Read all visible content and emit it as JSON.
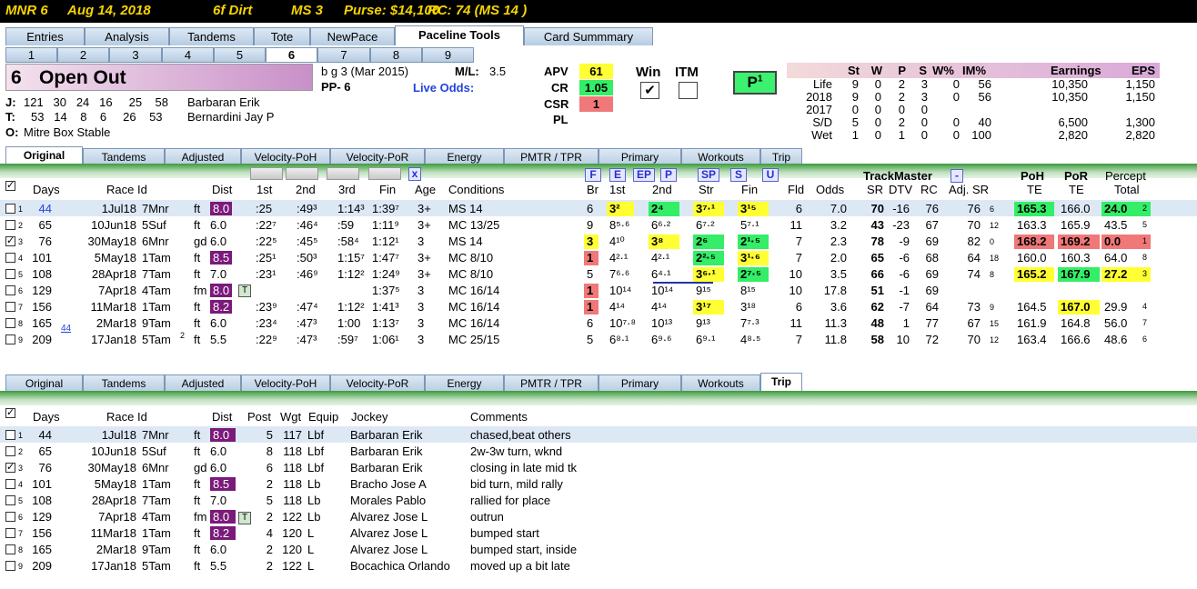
{
  "header": {
    "track": "MNR  6",
    "date": "Aug 14, 2018",
    "dist": "6f  Dirt",
    "cls": "MS  3",
    "purse": "Purse: $14,100",
    "rc": "RC: 74  (MS 14 )"
  },
  "main_tabs": [
    "Entries",
    "Analysis",
    "Tandems",
    "Tote",
    "NewPace",
    "Paceline Tools",
    "Card Summmary"
  ],
  "race_tabs": [
    "1",
    "2",
    "3",
    "4",
    "5",
    "6",
    "7",
    "8",
    "9"
  ],
  "horse": {
    "num": "6",
    "name": "Open Out",
    "desc": "b g 3  (Mar 2015)",
    "pp": "PP- 6",
    "ml_label": "M/L:",
    "ml": "3.5",
    "live": "Live Odds:",
    "j_label": "J:",
    "j_stats": "121   30   24   16     25    58",
    "jockey": "Barbaran Erik",
    "t_label": "T:",
    "t_stats": "53   14    8    6     26    53",
    "trainer": "Bernardini Jay P",
    "o_label": "O:",
    "owner": "Mitre Box Stable"
  },
  "ratings": {
    "apv_l": "APV",
    "apv": "61",
    "cr_l": "CR",
    "cr": "1.05",
    "csr_l": "CSR",
    "csr": "1",
    "pl_l": "PL",
    "win": "Win",
    "itm": "ITM",
    "p": "P",
    "p_sup": "1"
  },
  "stats": {
    "head": [
      "St",
      "W",
      "P",
      "S",
      "W%",
      "IM%",
      "Earnings",
      "EPS"
    ],
    "rows": [
      [
        "Life",
        "9",
        "0",
        "2",
        "3",
        "0",
        "56",
        "10,350",
        "1,150"
      ],
      [
        "2018",
        "9",
        "0",
        "2",
        "3",
        "0",
        "56",
        "10,350",
        "1,150"
      ],
      [
        "2017",
        "0",
        "0",
        "0",
        "0",
        "",
        "",
        "",
        ""
      ],
      [
        "S/D",
        "5",
        "0",
        "2",
        "0",
        "0",
        "40",
        "6,500",
        "1,300"
      ],
      [
        "Wet",
        "1",
        "0",
        "1",
        "0",
        "0",
        "100",
        "2,820",
        "2,820"
      ]
    ]
  },
  "view_tabs": [
    "Original",
    "Tandems",
    "Adjusted",
    "Velocity-PoH",
    "Velocity-PoR",
    "Energy",
    "PMTR / TPR",
    "Primary",
    "Workouts",
    "Trip"
  ],
  "pp_head": {
    "days": "Days",
    "raceid": "Race Id",
    "dist": "Dist",
    "c1": "1st",
    "c2": "2nd",
    "c3": "3rd",
    "fin": "Fin",
    "age": "Age",
    "cond": "Conditions",
    "x": "x",
    "btn": [
      "F",
      "E",
      "EP",
      "P",
      "SP",
      "S",
      "U"
    ],
    "br": "Br",
    "p1": "1st",
    "p2": "2nd",
    "str": "Str",
    "pfin": "Fin",
    "fld": "Fld",
    "odds": "Odds",
    "tm": "TrackMaster",
    "sr": "SR",
    "dtv": "DTV",
    "rc": "RC",
    "adjsr": "Adj. SR",
    "minus": "-",
    "poh": "PoH",
    "te1": "TE",
    "por": "PoR",
    "te2": "TE",
    "pct": "Percept",
    "total": "Total"
  },
  "pp_rows": [
    [
      "1",
      "44",
      "1Jul18",
      "7Mnr",
      "ft",
      "8.0",
      ":25",
      ":49³",
      "1:14³",
      "1:39⁷",
      "3+",
      "MS 14",
      "6",
      "3²",
      "2⁴",
      "3⁷·¹",
      "3¹⁵",
      "6",
      "7.0",
      "70",
      "-16",
      "76",
      "76",
      "6",
      "165.3",
      "166.0",
      "24.0",
      "2"
    ],
    [
      "2",
      "65",
      "10Jun18",
      "5Suf",
      "ft",
      "6.0",
      ":22⁷",
      ":46⁴",
      ":59",
      "1:11⁹",
      "3+",
      "MC 13/25",
      "9",
      "8⁵·⁶",
      "6⁶·²",
      "6⁷·²",
      "5⁷·¹",
      "11",
      "3.2",
      "43",
      "-23",
      "67",
      "70",
      "12",
      "163.3",
      "165.9",
      "43.5",
      "5"
    ],
    [
      "3",
      "76",
      "30May18",
      "6Mnr",
      "gd",
      "6.0",
      ":22⁵",
      ":45⁵",
      ":58⁴",
      "1:12¹",
      "3",
      "MS 14",
      "3",
      "4¹⁰",
      "3⁸",
      "2⁶",
      "2¹·⁵",
      "7",
      "2.3",
      "78",
      "-9",
      "69",
      "82",
      "0",
      "168.2",
      "169.2",
      "0.0",
      "1"
    ],
    [
      "4",
      "101",
      "5May18",
      "1Tam",
      "ft",
      "8.5",
      ":25¹",
      ":50³",
      "1:15⁷",
      "1:47⁷",
      "3+",
      "MC 8/10",
      "1",
      "4²·¹",
      "4²·¹",
      "2²·⁵",
      "3¹·⁶",
      "7",
      "2.0",
      "65",
      "-6",
      "68",
      "64",
      "18",
      "160.0",
      "160.3",
      "64.0",
      "8"
    ],
    [
      "5",
      "108",
      "28Apr18",
      "7Tam",
      "ft",
      "7.0",
      ":23¹",
      ":46⁹",
      "1:12²",
      "1:24⁹",
      "3+",
      "MC 8/10",
      "5",
      "7⁶·⁶",
      "6⁴·¹",
      "3⁶·¹",
      "2⁷·⁵",
      "10",
      "3.5",
      "66",
      "-6",
      "69",
      "74",
      "8",
      "165.2",
      "167.9",
      "27.2",
      "3"
    ],
    [
      "6",
      "129",
      "7Apr18",
      "4Tam",
      "fm",
      "8.0",
      "",
      "",
      "",
      "1:37⁵",
      "3",
      "MC 16/14",
      "1",
      "10¹⁴",
      "10¹⁴",
      "9¹⁵",
      "8¹⁵",
      "10",
      "17.8",
      "51",
      "-1",
      "69",
      "",
      "",
      "",
      "",
      "",
      ""
    ],
    [
      "7",
      "156",
      "11Mar18",
      "1Tam",
      "ft",
      "8.2",
      ":23⁹",
      ":47⁴",
      "1:12²",
      "1:41³",
      "3",
      "MC 16/14",
      "1",
      "4¹⁴",
      "4¹⁴",
      "3¹⁷",
      "3¹⁸",
      "6",
      "3.6",
      "62",
      "-7",
      "64",
      "73",
      "9",
      "164.5",
      "167.0",
      "29.9",
      "4"
    ],
    [
      "8",
      "165",
      "2Mar18",
      "9Tam",
      "ft",
      "6.0",
      ":23⁴",
      ":47³",
      "1:00",
      "1:13⁷",
      "3",
      "MC 16/14",
      "6",
      "10⁷·⁸",
      "10¹³",
      "9¹³",
      "7⁷·³",
      "11",
      "11.3",
      "48",
      "1",
      "77",
      "67",
      "15",
      "161.9",
      "164.8",
      "56.0",
      "7"
    ],
    [
      "9",
      "209",
      "17Jan18",
      "5Tam",
      "ft",
      "5.5",
      ":22⁹",
      ":47³",
      ":59⁷",
      "1:06¹",
      "3",
      "MC 25/15",
      "5",
      "6⁸·¹",
      "6⁹·⁶",
      "6⁹·¹",
      "4⁸·⁵",
      "7",
      "11.8",
      "58",
      "10",
      "72",
      "70",
      "12",
      "163.4",
      "166.6",
      "48.6",
      "6"
    ]
  ],
  "pp_extra": {
    "r8_sub": "44",
    "r9_sup": "2",
    "r6_t": "T",
    "r7_t": "T"
  },
  "trip_head": {
    "days": "Days",
    "raceid": "Race Id",
    "dist": "Dist",
    "post": "Post",
    "wgt": "Wgt",
    "equip": "Equip",
    "jockey": "Jockey",
    "comments": "Comments"
  },
  "trip_rows": [
    [
      "1",
      "44",
      "1Jul18",
      "7Mnr",
      "ft",
      "8.0",
      "5",
      "117",
      "Lbf",
      "Barbaran Erik",
      "chased,beat others"
    ],
    [
      "2",
      "65",
      "10Jun18",
      "5Suf",
      "ft",
      "6.0",
      "8",
      "118",
      "Lbf",
      "Barbaran Erik",
      "2w-3w turn, wknd"
    ],
    [
      "3",
      "76",
      "30May18",
      "6Mnr",
      "gd",
      "6.0",
      "6",
      "118",
      "Lbf",
      "Barbaran Erik",
      "closing in late mid tk"
    ],
    [
      "4",
      "101",
      "5May18",
      "1Tam",
      "ft",
      "8.5",
      "2",
      "118",
      "Lb",
      "Bracho Jose A",
      "bid turn, mild rally"
    ],
    [
      "5",
      "108",
      "28Apr18",
      "7Tam",
      "ft",
      "7.0",
      "5",
      "118",
      "Lb",
      "Morales Pablo",
      "rallied for place"
    ],
    [
      "6",
      "129",
      "7Apr18",
      "4Tam",
      "fm",
      "8.0",
      "2",
      "122",
      "Lb",
      "Alvarez Jose L",
      "outrun"
    ],
    [
      "7",
      "156",
      "11Mar18",
      "1Tam",
      "ft",
      "8.2",
      "4",
      "120",
      "L",
      "Alvarez Jose L",
      "bumped start"
    ],
    [
      "8",
      "165",
      "2Mar18",
      "9Tam",
      "ft",
      "6.0",
      "2",
      "120",
      "L",
      "Alvarez Jose L",
      "bumped start, inside"
    ],
    [
      "9",
      "209",
      "17Jan18",
      "5Tam",
      "ft",
      "5.5",
      "2",
      "122",
      "L",
      "Bocachica Orlando",
      "moved up a bit late"
    ]
  ]
}
